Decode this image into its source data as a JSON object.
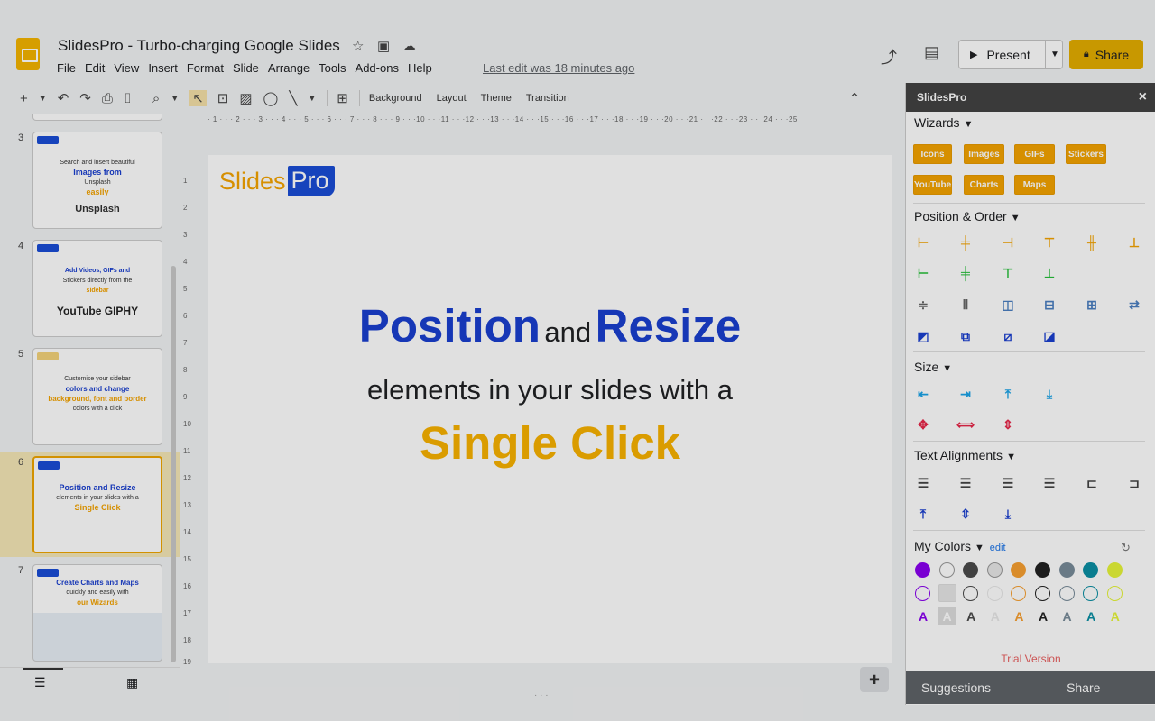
{
  "app": {
    "title": "SlidesPro - Turbo-charging Google Slides",
    "last_edit": "Last edit was 18 minutes ago",
    "present_label": "Present",
    "share_label": "Share"
  },
  "menu": [
    "File",
    "Edit",
    "View",
    "Insert",
    "Format",
    "Slide",
    "Arrange",
    "Tools",
    "Add-ons",
    "Help"
  ],
  "toolbar": {
    "background": "Background",
    "layout": "Layout",
    "theme": "Theme",
    "transition": "Transition"
  },
  "ruler": {
    "top": "· 1 · · · 2 · · · 3 · · · 4 · · · 5 · · · 6 · · · 7 · · · 8 · · · 9 · · ·10 · · ·11 · · ·12 · · ·13 · · ·14 · · ·15 · · ·16 · · ·17 · · ·18 · · ·19 · · ·20 · · ·21 · · ·22 · · ·23 · · ·24 · · ·25",
    "left": [
      "1",
      "2",
      "3",
      "4",
      "5",
      "6",
      "7",
      "8",
      "9",
      "10",
      "11",
      "12",
      "13",
      "14",
      "15",
      "16",
      "17",
      "18",
      "19"
    ]
  },
  "filmstrip": [
    {
      "num": "3",
      "lines": [
        "Search and insert beautiful",
        "Images from",
        "Unsplash",
        "easily",
        "Unsplash"
      ]
    },
    {
      "num": "4",
      "lines": [
        "Add Videos, GIFs and",
        "Stickers directly from the",
        "sidebar",
        "YouTube  GIPHY"
      ]
    },
    {
      "num": "5",
      "lines": [
        "Customise your sidebar",
        "colors and change",
        "background, font and border",
        "colors with a click"
      ]
    },
    {
      "num": "6",
      "lines": [
        "Position and Resize",
        "elements in your slides with a",
        "Single Click"
      ]
    },
    {
      "num": "7",
      "lines": [
        "Create Charts and Maps",
        "quickly and easily with",
        "our Wizards"
      ]
    }
  ],
  "slide": {
    "logo_slides": "Slides",
    "logo_pro": "Pro",
    "word1": "Position",
    "and": "and",
    "word2": "Resize",
    "line2": "elements in your slides with a",
    "line3": "Single Click"
  },
  "sidebar": {
    "title": "SlidesPro",
    "close": "×",
    "wizards_title": "Wizards",
    "wizards": [
      "Icons",
      "Images",
      "GIFs",
      "Stickers",
      "YouTube",
      "Charts",
      "Maps"
    ],
    "position_title": "Position & Order",
    "size_title": "Size",
    "text_align_title": "Text Alignments",
    "colors_title": "My Colors",
    "colors_edit": "edit",
    "colors": [
      "#8a00f0",
      "#ffffff",
      "#4a4a4a",
      "#e8e8e8",
      "#f7a032",
      "#222222",
      "#788b99",
      "#0b8fa3",
      "#e6f53a"
    ],
    "font_letter": "A",
    "trial": "Trial Version",
    "footer": {
      "suggestions": "Suggestions",
      "share": "Share"
    }
  }
}
